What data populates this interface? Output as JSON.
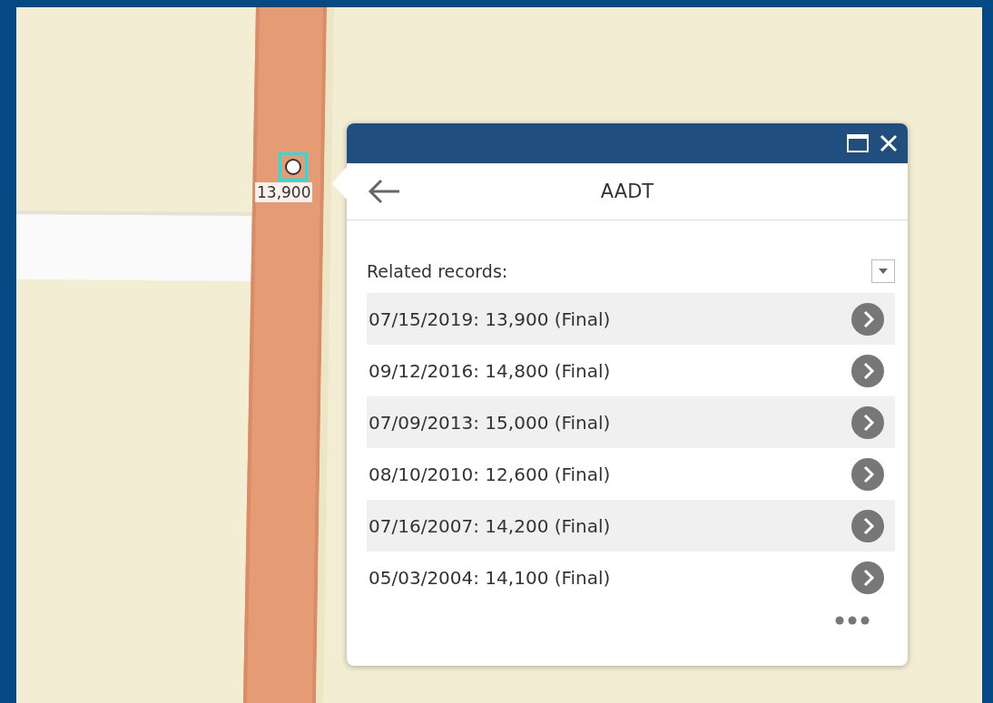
{
  "map": {
    "feature_label": "13,900"
  },
  "popup": {
    "title": "AADT",
    "section_label": "Related records:",
    "records": [
      {
        "text": "07/15/2019: 13,900 (Final)"
      },
      {
        "text": "09/12/2016: 14,800 (Final)"
      },
      {
        "text": "07/09/2013: 15,000 (Final)"
      },
      {
        "text": "08/10/2010: 12,600 (Final)"
      },
      {
        "text": "07/16/2007: 14,200 (Final)"
      },
      {
        "text": "05/03/2004: 14,100 (Final)"
      }
    ]
  }
}
